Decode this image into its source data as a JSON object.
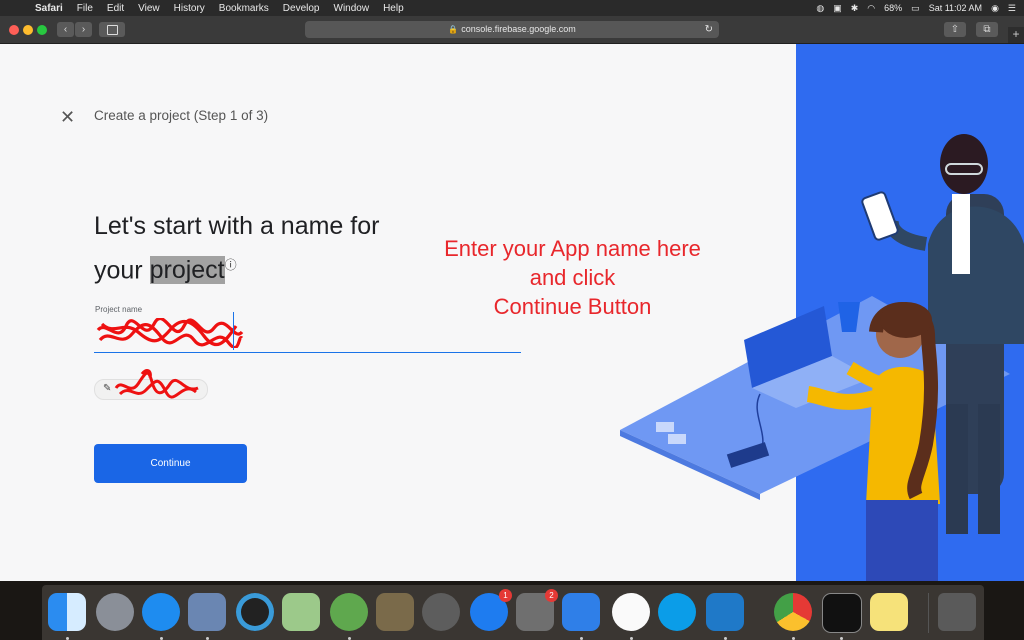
{
  "menubar": {
    "app_name": "Safari",
    "menus": [
      "File",
      "Edit",
      "View",
      "History",
      "Bookmarks",
      "Develop",
      "Window",
      "Help"
    ],
    "battery": "68%",
    "clock": "Sat 11:02 AM"
  },
  "browser": {
    "url": "console.firebase.google.com"
  },
  "page": {
    "step_title": "Create a project (Step 1 of 3)",
    "heading_line1": "Let's start with a name for",
    "heading_line2_plain": "your ",
    "heading_line2_highlight": "project",
    "project_name_label": "Project name",
    "continue_label": "Continue"
  },
  "annotation": {
    "line1": "Enter your App name here",
    "line2": "and  click",
    "line3": "Continue Button"
  },
  "dock": {
    "app_store_badge": "1",
    "system_prefs_badge": "2"
  },
  "colors": {
    "primary_blue": "#1a66e6",
    "annotation_red": "#e8272c",
    "illustration_blue": "#2f6bf0"
  }
}
